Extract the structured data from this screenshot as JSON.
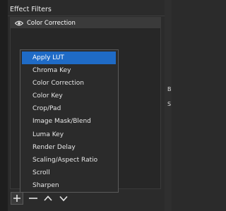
{
  "panel": {
    "title": "Effect Filters",
    "filters": [
      {
        "label": "Color Correction",
        "visible": true
      }
    ]
  },
  "menu": {
    "items": [
      {
        "label": "Apply LUT",
        "active": true
      },
      {
        "label": "Chroma Key",
        "active": false
      },
      {
        "label": "Color Correction",
        "active": false
      },
      {
        "label": "Color Key",
        "active": false
      },
      {
        "label": "Crop/Pad",
        "active": false
      },
      {
        "label": "Image Mask/Blend",
        "active": false
      },
      {
        "label": "Luma Key",
        "active": false
      },
      {
        "label": "Render Delay",
        "active": false
      },
      {
        "label": "Scaling/Aspect Ratio",
        "active": false
      },
      {
        "label": "Scroll",
        "active": false
      },
      {
        "label": "Sharpen",
        "active": false
      }
    ]
  },
  "toolbar": {
    "buttons": [
      "plus-icon",
      "minus-icon",
      "chevron-up-icon",
      "chevron-down-icon"
    ]
  },
  "side_panel": {
    "letters": [
      "B",
      "S"
    ]
  },
  "colors": {
    "highlight": "#1f6bc6",
    "panel_bg": "#2b2b2b",
    "row_bg": "#3a3a3a"
  }
}
